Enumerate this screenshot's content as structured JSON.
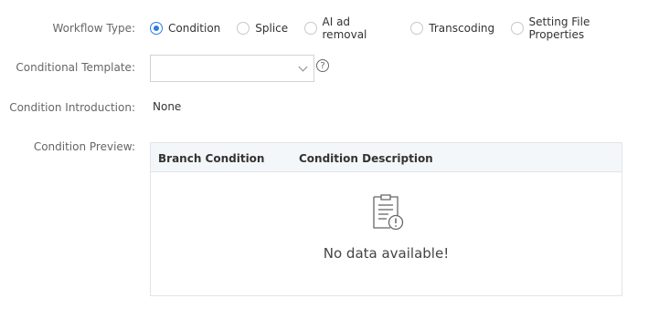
{
  "workflow_type": {
    "label": "Workflow Type:",
    "options": [
      {
        "label": "Condition",
        "checked": true
      },
      {
        "label": "Splice",
        "checked": false
      },
      {
        "label": "AI ad removal",
        "checked": false
      },
      {
        "label": "Transcoding",
        "checked": false
      },
      {
        "label": "Setting File Properties",
        "checked": false
      }
    ]
  },
  "conditional_template": {
    "label": "Conditional Template:",
    "value": "",
    "help": "?"
  },
  "condition_introduction": {
    "label": "Condition Introduction:",
    "value": "None"
  },
  "condition_preview": {
    "label": "Condition Preview:",
    "columns": [
      "Branch Condition",
      "Condition Description"
    ],
    "rows": [],
    "empty_text": "No data available!"
  },
  "colors": {
    "accent": "#2d7be5",
    "table_header_bg": "#f4f7fa",
    "label_text": "#666666"
  }
}
